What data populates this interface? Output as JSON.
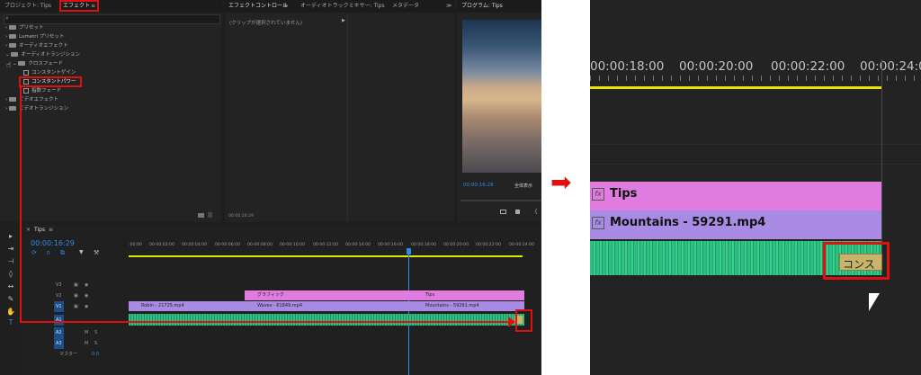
{
  "project_panel": {
    "tab_project": "プロジェクト: Tips",
    "tab_effects": "エフェクト",
    "menu_glyph": "≡",
    "search_placeholder": "",
    "tree": [
      {
        "label": "プリセット",
        "indent": 0,
        "kind": "folder"
      },
      {
        "label": "Lumetri プリセット",
        "indent": 0,
        "kind": "folder"
      },
      {
        "label": "オーディオエフェクト",
        "indent": 0,
        "kind": "folder"
      },
      {
        "label": "オーディオトランジション",
        "indent": 0,
        "kind": "folder"
      },
      {
        "label": "クロスフェード",
        "indent": 1,
        "kind": "folder"
      },
      {
        "label": "コンスタントゲイン",
        "indent": 2,
        "kind": "fx"
      },
      {
        "label": "コンスタントパワー",
        "indent": 2,
        "kind": "fx"
      },
      {
        "label": "指数フェード",
        "indent": 2,
        "kind": "fx"
      },
      {
        "label": "ビデオエフェクト",
        "indent": 0,
        "kind": "folder"
      },
      {
        "label": "ビデオトランジション",
        "indent": 0,
        "kind": "folder"
      }
    ]
  },
  "effect_controls": {
    "tab_effect_controls": "エフェクトコントロール",
    "tab_audio_mixer": "オーディオトラックミキサー: Tips",
    "tab_metadata": "メタデータ",
    "overflow": "≫",
    "empty_message": "(クリップが選択されていません)",
    "timecode": "00:00:16:29"
  },
  "program_monitor": {
    "title": "プログラム: Tips",
    "timecode": "00:00:16:29",
    "fit_label": "全体表示"
  },
  "timeline": {
    "sequence_name": "Tips",
    "timecode": "00:00:16:29",
    "ruler_labels": [
      ":00:00",
      "00:00:02:00",
      "00:00:04:00",
      "00:00:06:00",
      "00:00:08:00",
      "00:00:10:00",
      "00:00:12:00",
      "00:00:14:00",
      "00:00:16:00",
      "00:00:18:00",
      "00:00:20:00",
      "00:00:22:00",
      "00:00:24:00"
    ],
    "tracks": [
      {
        "name": "V3"
      },
      {
        "name": "V2"
      },
      {
        "name": "V1"
      },
      {
        "name": "A1"
      },
      {
        "name": "A2"
      },
      {
        "name": "A3"
      }
    ],
    "master_label": "マスター",
    "master_value": "0.0",
    "clips": {
      "graphic": "グラフィック",
      "tips": "Tips",
      "robin": "Robin - 21725.mp4",
      "waves": "Waves - 61849.mp4",
      "mountains": "Mountains - 59291.mp4"
    }
  },
  "zoom_view": {
    "ruler_labels": [
      "00:00:18:00",
      "00:00:20:00",
      "00:00:22:00",
      "00:00:24:00"
    ],
    "clip_tips": "Tips",
    "clip_mountains": "Mountains - 59291.mp4",
    "transition_label": "コンス",
    "fx_glyph": "fx"
  },
  "arrow_glyph": "➡",
  "colors": {
    "highlight_red": "#e01010",
    "accent_blue": "#2d8ceb",
    "graphic_clip": "#e07be0",
    "video_clip": "#a98be6",
    "audio_clip": "#2fbf82",
    "work_area_yellow": "#e6e600"
  }
}
